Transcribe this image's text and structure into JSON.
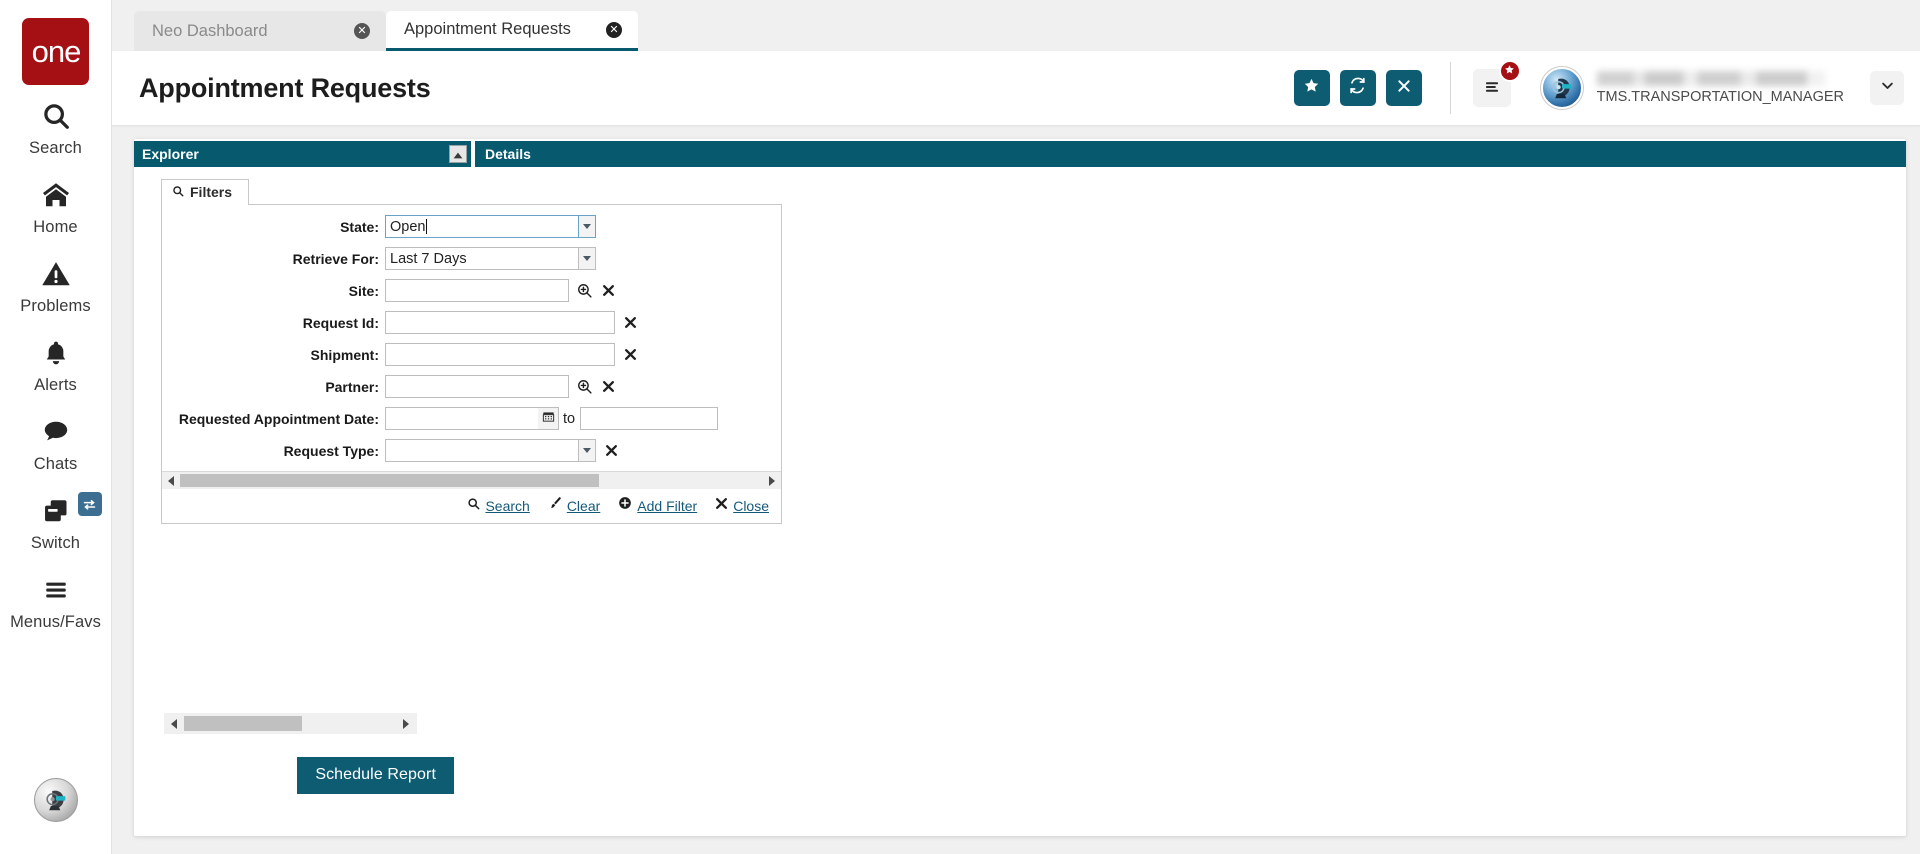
{
  "brand": {
    "logo_text": "one",
    "logo_color": "#a51014"
  },
  "rail": {
    "items": [
      {
        "label": "Search",
        "icon": "search-icon"
      },
      {
        "label": "Home",
        "icon": "home-icon"
      },
      {
        "label": "Problems",
        "icon": "warning-triangle-icon"
      },
      {
        "label": "Alerts",
        "icon": "bell-icon"
      },
      {
        "label": "Chats",
        "icon": "chat-bubble-icon"
      },
      {
        "label": "Switch",
        "icon": "windows-stack-icon",
        "badge_icon": "swap-arrows-icon"
      },
      {
        "label": "Menus/Favs",
        "icon": "hamburger-icon"
      }
    ],
    "avatar_icon": "robot-head-avatar-icon"
  },
  "tabs": [
    {
      "label": "Neo Dashboard",
      "active": false,
      "close_icon": "close-circle-icon"
    },
    {
      "label": "Appointment Requests",
      "active": true,
      "close_icon": "close-circle-icon"
    }
  ],
  "header": {
    "title": "Appointment Requests",
    "actions": [
      {
        "name": "favorite-button",
        "icon": "star-icon"
      },
      {
        "name": "refresh-button",
        "icon": "refresh-icon"
      },
      {
        "name": "close-button",
        "icon": "x-icon"
      }
    ],
    "menu": {
      "icon": "hamburger-icon",
      "badge_icon": "star-icon",
      "badge_color": "#a51014"
    },
    "user": {
      "name": "TMS.TRANSPORTATION_MANAGER",
      "avatar_icon": "robot-head-avatar-icon",
      "caret_icon": "chevron-down-icon"
    },
    "accent_color": "#0d5c72"
  },
  "panels": {
    "explorer": {
      "title": "Explorer",
      "collapse_icon": "caret-up-icon"
    },
    "details": {
      "title": "Details"
    },
    "bar_color": "#075a6e"
  },
  "filters": {
    "tab_label": "Filters",
    "tab_icon": "search-icon",
    "fields": [
      {
        "label": "State:",
        "type": "select",
        "value": "Open",
        "focused": true,
        "icon": "chevron-down-icon"
      },
      {
        "label": "Retrieve For:",
        "type": "select",
        "value": "Last 7  Days",
        "focused": false,
        "icon": "chevron-down-icon"
      },
      {
        "label": "Site:",
        "type": "lookup",
        "value": "",
        "icons": [
          "magnifier-plus-icon",
          "clear-x-icon"
        ]
      },
      {
        "label": "Request Id:",
        "type": "text",
        "value": "",
        "icons": [
          "clear-x-icon"
        ]
      },
      {
        "label": "Shipment:",
        "type": "text",
        "value": "",
        "icons": [
          "clear-x-icon"
        ]
      },
      {
        "label": "Partner:",
        "type": "lookup",
        "value": "",
        "icons": [
          "magnifier-plus-icon",
          "clear-x-icon"
        ]
      },
      {
        "label": "Requested Appointment Date:",
        "type": "daterange",
        "value_from": "",
        "value_to": "",
        "separator": "to",
        "icons": [
          "calendar-icon"
        ]
      },
      {
        "label": "Request Type:",
        "type": "select",
        "value": "",
        "icons": [
          "chevron-down-icon",
          "clear-x-icon"
        ]
      }
    ],
    "actions": [
      {
        "label": "Search",
        "icon": "search-icon"
      },
      {
        "label": "Clear",
        "icon": "brush-icon"
      },
      {
        "label": "Add Filter",
        "icon": "plus-circle-icon"
      },
      {
        "label": "Close",
        "icon": "x-icon"
      }
    ],
    "link_color": "#15597a"
  },
  "footer": {
    "schedule_button": "Schedule Report",
    "button_color": "#0d5c72",
    "scroll_left_icon": "triangle-left-icon",
    "scroll_right_icon": "triangle-right-icon"
  }
}
